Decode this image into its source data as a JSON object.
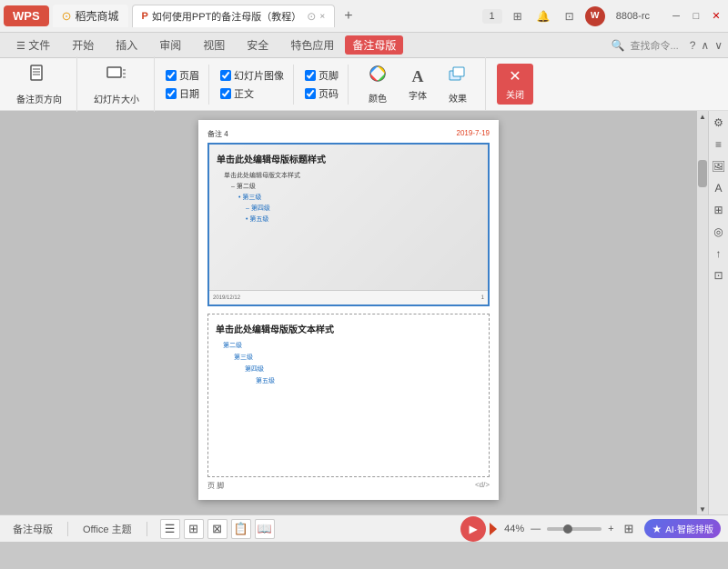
{
  "titlebar": {
    "wps_label": "WPS",
    "tab_mahogany": "稻壳商城",
    "tab_doc": "如何使用PPT的备注母版（教程）",
    "tab_close": "×",
    "tab_add": "+",
    "tab_count": "1",
    "search_placeholder": "查找命令...",
    "help": "?",
    "wps_account": "W",
    "account_name": "8808-rc",
    "min_btn": "─",
    "max_btn": "□",
    "close_btn": "×"
  },
  "menubar": {
    "file": "文件",
    "start": "开始",
    "insert": "插入",
    "review": "审阅",
    "view": "视图",
    "security": "安全",
    "special_color": "特色应用",
    "notes_master": "备注母版",
    "search": "查找命令..."
  },
  "toolbar": {
    "notes_direction": "备注页方向",
    "slide_size": "幻灯片大小",
    "header": "页眉",
    "slide_image": "幻灯片图像",
    "footer": "页脚",
    "color": "颜色",
    "date": "日期",
    "body": "正文",
    "page_num": "页码",
    "font": "字体",
    "effect": "效果",
    "close": "关闭"
  },
  "page": {
    "header_left": "备注 4",
    "date_right": "2019-7-19",
    "slide_title": "单击此处编辑母版标题样式",
    "slide_bullet1": "单击此处编辑母版文本样式",
    "slide_bullet2": "– 第二级",
    "slide_bullet3": "• 第三级",
    "slide_bullet4": "– 第四级",
    "slide_bullet5": "• 第五级",
    "slide_footer_left": "2019/12/12",
    "slide_footer_right": "1",
    "notes_title": "单击此处编辑母版版文本样式",
    "notes_line2": "第二级",
    "notes_line3": "第三级",
    "notes_line4": "第四级",
    "notes_line5": "第五级",
    "page_footer_left": "页 脚",
    "page_footer_right": "<d/>"
  },
  "statusbar": {
    "notes_master": "备注母版",
    "office_theme": "Office 主题",
    "zoom_level": "44%",
    "ai_label": "AI·智能排版"
  }
}
